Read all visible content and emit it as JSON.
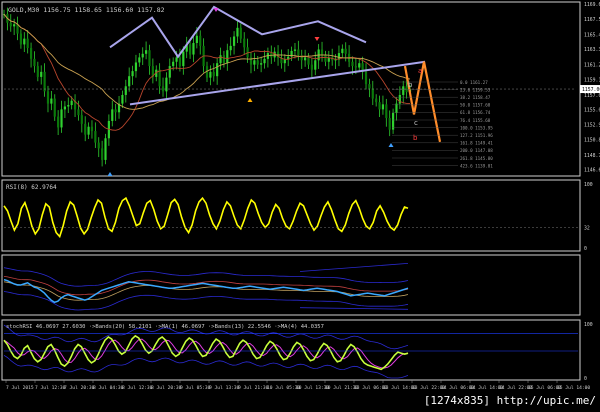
{
  "header": {
    "symbol_line": "GOLD,M30  1156.75  1158.65  1156.60  1157.82"
  },
  "chart_data": [
    {
      "type": "candlestick",
      "panel": "price",
      "ylim": [
        1146.05,
        1169.6
      ],
      "y_ticks": [
        "1169.60",
        "1167.55",
        "1165.40",
        "1163.35",
        "1161.25",
        "1159.15",
        "1157.00",
        "1155.00",
        "1152.90",
        "1150.80",
        "1148.70",
        "1146.65"
      ],
      "current_price_label": "1157.00",
      "closes": [
        1168.2,
        1167.0,
        1166.5,
        1166.8,
        1165.5,
        1164.0,
        1164.8,
        1163.5,
        1162.0,
        1161.0,
        1159.5,
        1160.2,
        1157.5,
        1155.8,
        1156.5,
        1154.0,
        1152.5,
        1155.0,
        1155.4,
        1155.6,
        1156.2,
        1155.0,
        1154.2,
        1153.0,
        1151.5,
        1152.6,
        1152.0,
        1150.4,
        1149.6,
        1148.0,
        1151.0,
        1153.4,
        1155.0,
        1154.6,
        1155.8,
        1157.0,
        1158.2,
        1159.6,
        1160.3,
        1161.5,
        1162.2,
        1162.7,
        1163.2,
        1161.0,
        1159.5,
        1160.5,
        1158.2,
        1157.5,
        1159.4,
        1161.0,
        1161.6,
        1162.2,
        1161.0,
        1163.0,
        1164.0,
        1162.6,
        1164.2,
        1165.2,
        1163.8,
        1161.0,
        1159.4,
        1160.2,
        1159.6,
        1161.4,
        1162.5,
        1161.4,
        1163.2,
        1163.8,
        1165.1,
        1166.3,
        1164.8,
        1163.6,
        1162.2,
        1161.2,
        1161.8,
        1161.2,
        1161.4,
        1162.0,
        1162.8,
        1162.2,
        1163.0,
        1162.1,
        1161.4,
        1161.9,
        1162.3,
        1163.1,
        1163.3,
        1162.5,
        1161.8,
        1162.2,
        1161.2,
        1160.5,
        1161.8,
        1163.3,
        1162.5,
        1161.6,
        1162.2,
        1161.8,
        1161.9,
        1162.8,
        1163.4,
        1162.7,
        1161.6,
        1161.0,
        1160.8,
        1161.4,
        1160.2,
        1158.5,
        1157.9,
        1156.5,
        1156.0,
        1155.0,
        1155.7,
        1153.8,
        1152.2,
        1154.5,
        1155.8,
        1157.0,
        1158.2,
        1157.4,
        1157.82
      ],
      "annotations": {
        "fib_levels": [
          "0.0 1161.27",
          "23.6 1159.53",
          "38.2 1158.47",
          "50.0 1157.60",
          "61.8 1156.74",
          "76.4 1155.68",
          "100.0 1153.95",
          "127.2 1151.96",
          "161.8 1149.41",
          "200.0 1147.08",
          "261.8 1145.80",
          "423.6 1139.01"
        ],
        "wave_labels": [
          "a",
          "b",
          "c",
          "b"
        ]
      }
    },
    {
      "type": "line",
      "panel": "oscillator",
      "label": "RSI(8) 62.9764",
      "ylim": [
        0,
        100
      ],
      "y_ticks": [
        "100",
        "32",
        "0"
      ],
      "values": [
        66,
        58,
        42,
        28,
        38,
        62,
        71,
        55,
        34,
        22,
        30,
        52,
        69,
        64,
        40,
        24,
        18,
        35,
        58,
        72,
        67,
        50,
        31,
        22,
        29,
        47,
        63,
        75,
        70,
        48,
        30,
        26,
        40,
        62,
        74,
        78,
        66,
        50,
        35,
        38,
        55,
        70,
        74,
        60,
        42,
        30,
        34,
        52,
        71,
        76,
        68,
        48,
        32,
        24,
        36,
        58,
        72,
        78,
        70,
        52,
        38,
        30,
        42,
        60,
        72,
        66,
        50,
        36,
        30,
        44,
        62,
        75,
        70,
        54,
        40,
        32,
        38,
        56,
        68,
        62,
        46,
        34,
        30,
        42,
        58,
        70,
        66,
        52,
        38,
        28,
        34,
        50,
        64,
        72,
        60,
        44,
        30,
        26,
        36,
        54,
        68,
        74,
        62,
        46,
        34,
        30,
        40,
        58,
        66,
        56,
        42,
        32,
        28,
        36,
        52,
        64,
        62
      ]
    },
    {
      "type": "line",
      "panel": "oscillator",
      "label": "",
      "ylim": [
        0,
        100
      ],
      "y_ticks": [],
      "values": [
        60,
        58,
        55,
        52,
        50,
        50,
        52,
        54,
        50,
        46,
        44,
        40,
        35,
        28,
        22,
        18,
        20,
        26,
        30,
        32,
        30,
        28,
        26,
        24,
        22,
        24,
        28,
        32,
        36,
        40,
        42,
        44,
        46,
        48,
        50,
        52,
        54,
        56,
        55,
        54,
        53,
        52,
        51,
        50,
        49,
        48,
        47,
        46,
        45,
        44,
        44,
        45,
        46,
        47,
        48,
        49,
        50,
        51,
        52,
        53,
        52,
        51,
        50,
        49,
        48,
        47,
        46,
        45,
        44,
        44,
        45,
        46,
        47,
        48,
        47,
        46,
        45,
        44,
        43,
        42,
        43,
        44,
        45,
        46,
        45,
        44,
        43,
        42,
        41,
        40,
        41,
        42,
        43,
        44,
        43,
        42,
        41,
        40,
        39,
        38,
        36,
        34,
        32,
        30,
        31,
        32,
        33,
        34,
        35,
        34,
        33,
        32,
        31,
        30,
        32,
        34,
        36,
        38,
        40,
        42,
        44
      ]
    },
    {
      "type": "line",
      "panel": "oscillator",
      "label": "stochRSI 46.0697 27.6030 ·>Bands(20) 58.2101 ·>MA(1) 46.0697 ·>Bands(13) 22.5546 ·>MA(4) 44.0357",
      "ylim": [
        0,
        100
      ],
      "y_ticks": [
        "100",
        "0"
      ],
      "values": [
        70,
        62,
        50,
        40,
        36,
        42,
        55,
        60,
        48,
        36,
        30,
        34,
        46,
        58,
        62,
        52,
        38,
        26,
        22,
        28,
        40,
        54,
        62,
        58,
        46,
        34,
        28,
        32,
        44,
        58,
        70,
        76,
        72,
        62,
        50,
        44,
        48,
        60,
        72,
        78,
        74,
        64,
        52,
        46,
        50,
        62,
        72,
        76,
        70,
        58,
        46,
        40,
        44,
        56,
        68,
        74,
        70,
        60,
        48,
        40,
        42,
        52,
        64,
        72,
        68,
        58,
        46,
        38,
        40,
        52,
        64,
        70,
        66,
        56,
        44,
        36,
        38,
        48,
        60,
        68,
        64,
        54,
        42,
        34,
        36,
        46,
        58,
        66,
        62,
        52,
        40,
        32,
        34,
        44,
        56,
        64,
        60,
        50,
        38,
        30,
        32,
        42,
        54,
        62,
        58,
        48,
        36,
        28,
        24,
        22,
        20,
        18,
        16,
        20,
        26,
        34,
        42,
        48,
        46,
        44,
        46
      ]
    }
  ],
  "x_axis": {
    "labels": [
      "7 Jul 2015",
      "7 Jul 12:30",
      "7 Jul 20:30",
      "8 Jul 04:30",
      "8 Jul 12:30",
      "8 Jul 20:30",
      "9 Jul 05:30",
      "9 Jul 13:30",
      "9 Jul 21:30",
      "10 Jul 05:30",
      "10 Jul 13:30",
      "10 Jul 21:30",
      "13 Jul 06:00",
      "13 Jul 14:00",
      "13 Jul 22:00",
      "14 Jul 06:00",
      "14 Jul 14:00",
      "14 Jul 22:00",
      "15 Jul 06:00",
      "15 Jul 14:00",
      "15 Jul 22:00",
      "16 Jul 06:00",
      "16 Jul 14:00",
      "16 Jul 22:00"
    ]
  },
  "watermark": "[1274x835]  http://upic.me/"
}
